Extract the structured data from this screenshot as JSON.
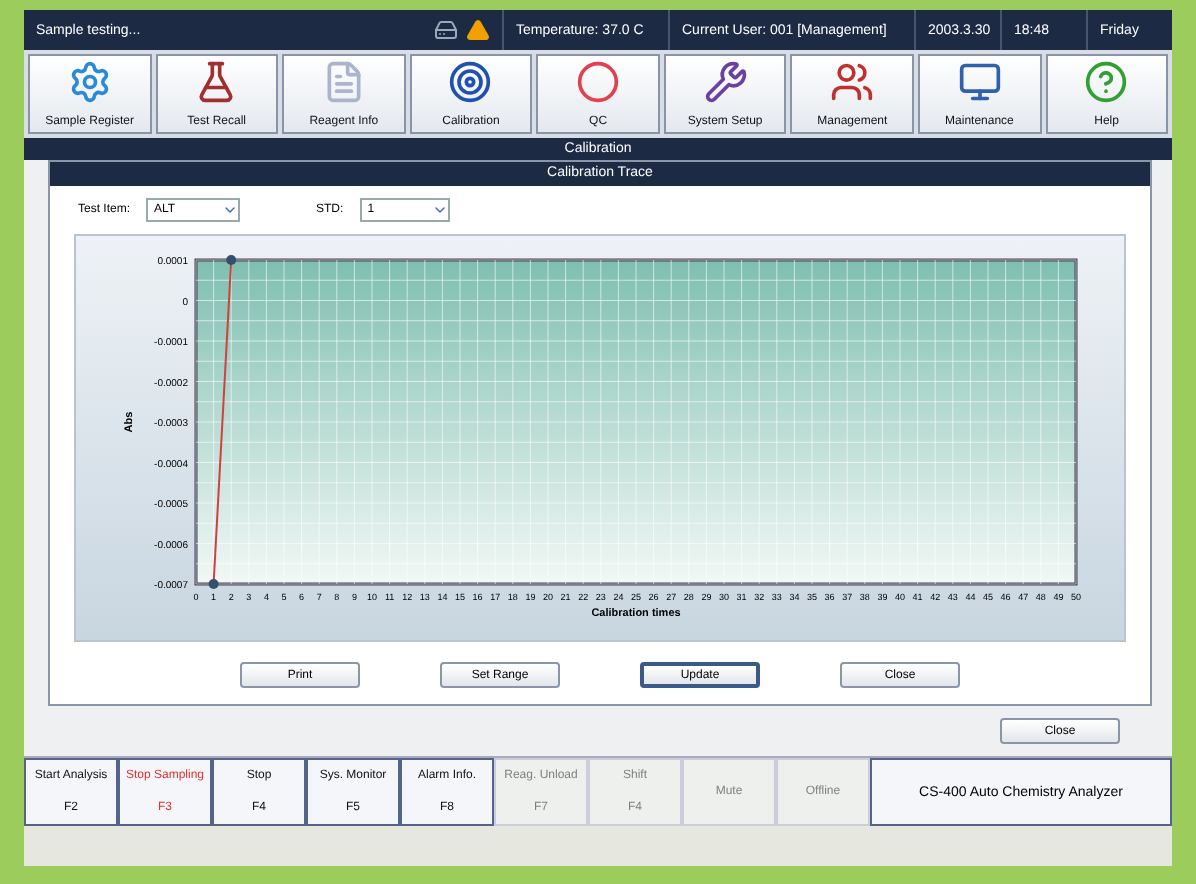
{
  "status_bar": {
    "message": "Sample testing...",
    "temperature": "Temperature: 37.0 C",
    "user": "Current User: 001 [Management]",
    "date": "2003.3.30",
    "time": "18:48",
    "weekday": "Friday"
  },
  "toolbar": [
    {
      "label": "Sample Register"
    },
    {
      "label": "Test Recall"
    },
    {
      "label": "Reagent Info"
    },
    {
      "label": "Calibration"
    },
    {
      "label": "QC"
    },
    {
      "label": "System Setup"
    },
    {
      "label": "Management"
    },
    {
      "label": "Maintenance"
    },
    {
      "label": "Help"
    }
  ],
  "screen_title": "Calibration",
  "dialog": {
    "title": "Calibration Trace",
    "test_item_label": "Test Item:",
    "test_item_value": "ALT",
    "std_label": "STD:",
    "std_value": "1",
    "chart_data": {
      "type": "line",
      "xlabel": "Calibration times",
      "ylabel": "Abs",
      "x": [
        1,
        2
      ],
      "grid": true,
      "series": [
        {
          "color": "#d04040",
          "marker": true,
          "values": [
            -0.0007,
            0.0001
          ]
        }
      ],
      "xlim": [
        0,
        50
      ],
      "ylim": [
        -0.0007,
        0.0001
      ],
      "xticks": [
        0,
        1,
        2,
        3,
        4,
        5,
        6,
        7,
        8,
        9,
        10,
        11,
        12,
        13,
        14,
        15,
        16,
        17,
        18,
        19,
        20,
        21,
        22,
        23,
        24,
        25,
        26,
        27,
        28,
        29,
        30,
        31,
        32,
        33,
        34,
        35,
        36,
        37,
        38,
        39,
        40,
        41,
        42,
        43,
        44,
        45,
        46,
        47,
        48,
        49,
        50
      ],
      "yticks": [
        {
          "value": 0.0001,
          "label": "0.0001"
        },
        {
          "value": 0,
          "label": "0"
        },
        {
          "value": -0.0001,
          "label": "-0.0001"
        },
        {
          "value": -0.0002,
          "label": "-0.0002"
        },
        {
          "value": -0.0003,
          "label": "-0.0003"
        },
        {
          "value": -0.0004,
          "label": "-0.0004"
        },
        {
          "value": -0.0005,
          "label": "-0.0005"
        },
        {
          "value": -0.0006,
          "label": "-0.0006"
        },
        {
          "value": -0.0007,
          "label": "-0.0007"
        }
      ]
    },
    "buttons": [
      {
        "label": "Print",
        "selected": false
      },
      {
        "label": "Set Range",
        "selected": false
      },
      {
        "label": "Update",
        "selected": true
      },
      {
        "label": "Close",
        "selected": false
      }
    ]
  },
  "close_button": "Close",
  "function_keys": [
    {
      "label": "Start Analysis",
      "key": "F2",
      "disabled": false,
      "alert": false
    },
    {
      "label": "Stop Sampling",
      "key": "F3",
      "disabled": false,
      "alert": true
    },
    {
      "label": "Stop",
      "key": "F4",
      "disabled": false,
      "alert": false
    },
    {
      "label": "Sys. Monitor",
      "key": "F5",
      "disabled": false,
      "alert": false
    },
    {
      "label": "Alarm Info.",
      "key": "F8",
      "disabled": false,
      "alert": false
    },
    {
      "label": "Reag. Unload",
      "key": "F7",
      "disabled": true,
      "alert": false
    },
    {
      "label": "Shift",
      "key": "F4",
      "disabled": true,
      "alert": false
    },
    {
      "label": "Mute",
      "disabled": true,
      "alert": false
    },
    {
      "label": "Offline",
      "disabled": true,
      "alert": false
    }
  ],
  "product_name": "CS-400 Auto Chemistry Analyzer"
}
